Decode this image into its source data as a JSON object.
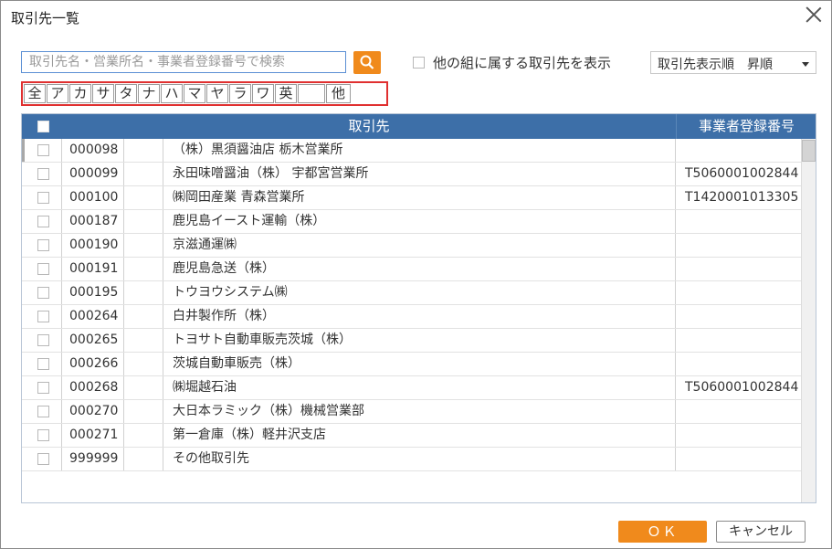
{
  "window": {
    "title": "取引先一覧"
  },
  "search": {
    "placeholder": "取引先名・営業所名・事業者登録番号で検索",
    "value": ""
  },
  "filter": {
    "other_group_label": "他の組に属する取引先を表示",
    "order_label": "取引先表示順　昇順"
  },
  "kana": [
    "全",
    "ア",
    "カ",
    "サ",
    "タ",
    "ナ",
    "ハ",
    "マ",
    "ヤ",
    "ラ",
    "ワ",
    "英",
    "",
    "他"
  ],
  "table": {
    "columns": [
      "",
      "取引先",
      "事業者登録番号"
    ],
    "rows": [
      {
        "code": "000098",
        "name": "（株）黒須醤油店 栃木営業所",
        "reg": ""
      },
      {
        "code": "000099",
        "name": "永田味噌醤油（株） 宇都宮営業所",
        "reg": "T5060001002844"
      },
      {
        "code": "000100",
        "name": "㈱岡田産業 青森営業所",
        "reg": "T1420001013305"
      },
      {
        "code": "000187",
        "name": "鹿児島イースト運輸（株）",
        "reg": ""
      },
      {
        "code": "000190",
        "name": "京滋通運㈱",
        "reg": ""
      },
      {
        "code": "000191",
        "name": "鹿児島急送（株）",
        "reg": ""
      },
      {
        "code": "000195",
        "name": "トウヨウシステム㈱",
        "reg": ""
      },
      {
        "code": "000264",
        "name": "白井製作所（株）",
        "reg": ""
      },
      {
        "code": "000265",
        "name": "トヨサト自動車販売茨城（株）",
        "reg": ""
      },
      {
        "code": "000266",
        "name": "茨城自動車販売（株）",
        "reg": ""
      },
      {
        "code": "000268",
        "name": "㈱堀越石油",
        "reg": "T5060001002844"
      },
      {
        "code": "000270",
        "name": "大日本ラミック（株）機械営業部",
        "reg": ""
      },
      {
        "code": "000271",
        "name": "第一倉庫（株）軽井沢支店",
        "reg": ""
      },
      {
        "code": "999999",
        "name": "その他取引先",
        "reg": ""
      }
    ]
  },
  "buttons": {
    "ok": "ＯＫ",
    "cancel": "キャンセル"
  },
  "colors": {
    "accent": "#f08a1c",
    "header": "#3d6fa8",
    "kana_highlight": "#e03030"
  }
}
